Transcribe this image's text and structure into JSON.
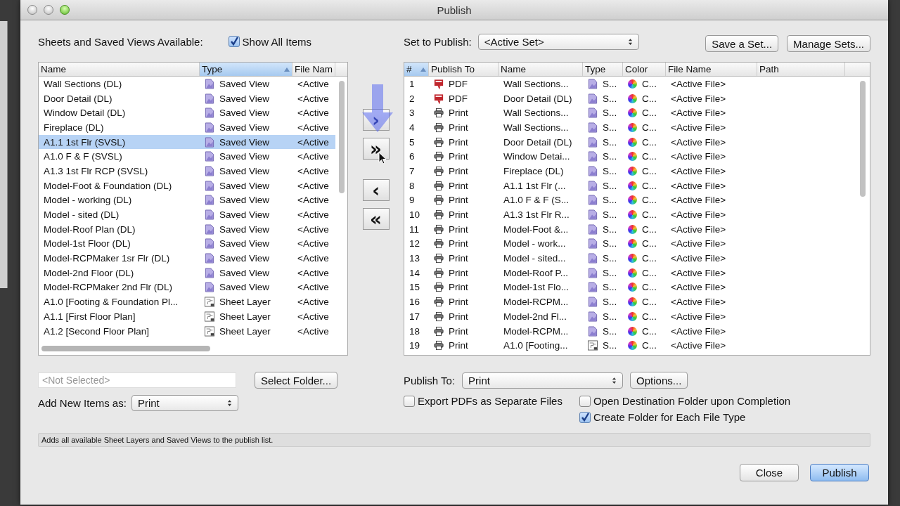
{
  "window": {
    "title": "Publish"
  },
  "available": {
    "label": "Sheets and Saved Views Available:",
    "show_all": {
      "label": "Show All Items",
      "checked": true
    },
    "columns": [
      {
        "label": "Name",
        "sorted": false
      },
      {
        "label": "Type",
        "sorted": true
      },
      {
        "label": "File Nam",
        "sorted": false
      }
    ],
    "rows": [
      {
        "name": "Wall Sections (DL)",
        "kind": "saved_view",
        "type": "Saved View",
        "file": "<Active",
        "selected": false
      },
      {
        "name": "Door Detail (DL)",
        "kind": "saved_view",
        "type": "Saved View",
        "file": "<Active",
        "selected": false
      },
      {
        "name": "Window Detail (DL)",
        "kind": "saved_view",
        "type": "Saved View",
        "file": "<Active",
        "selected": false
      },
      {
        "name": "Fireplace (DL)",
        "kind": "saved_view",
        "type": "Saved View",
        "file": "<Active",
        "selected": false
      },
      {
        "name": "A1.1 1st Flr (SVSL)",
        "kind": "saved_view",
        "type": "Saved View",
        "file": "<Active",
        "selected": true
      },
      {
        "name": "A1.0 F & F (SVSL)",
        "kind": "saved_view",
        "type": "Saved View",
        "file": "<Active",
        "selected": false
      },
      {
        "name": "A1.3 1st Flr RCP (SVSL)",
        "kind": "saved_view",
        "type": "Saved View",
        "file": "<Active",
        "selected": false
      },
      {
        "name": "Model-Foot & Foundation (DL)",
        "kind": "saved_view",
        "type": "Saved View",
        "file": "<Active",
        "selected": false
      },
      {
        "name": "Model - working (DL)",
        "kind": "saved_view",
        "type": "Saved View",
        "file": "<Active",
        "selected": false
      },
      {
        "name": "Model - sited (DL)",
        "kind": "saved_view",
        "type": "Saved View",
        "file": "<Active",
        "selected": false
      },
      {
        "name": "Model-Roof Plan (DL)",
        "kind": "saved_view",
        "type": "Saved View",
        "file": "<Active",
        "selected": false
      },
      {
        "name": "Model-1st Floor (DL)",
        "kind": "saved_view",
        "type": "Saved View",
        "file": "<Active",
        "selected": false
      },
      {
        "name": "Model-RCPMaker 1sr Flr (DL)",
        "kind": "saved_view",
        "type": "Saved View",
        "file": "<Active",
        "selected": false
      },
      {
        "name": "Model-2nd Floor (DL)",
        "kind": "saved_view",
        "type": "Saved View",
        "file": "<Active",
        "selected": false
      },
      {
        "name": "Model-RCPMaker 2nd Flr (DL)",
        "kind": "saved_view",
        "type": "Saved View",
        "file": "<Active",
        "selected": false
      },
      {
        "name": "A1.0 [Footing & Foundation Pl...",
        "kind": "sheet_layer",
        "type": "Sheet Layer",
        "file": "<Active",
        "selected": false
      },
      {
        "name": "A1.1 [First Floor Plan]",
        "kind": "sheet_layer",
        "type": "Sheet Layer",
        "file": "<Active",
        "selected": false
      },
      {
        "name": "A1.2 [Second Floor Plan]",
        "kind": "sheet_layer",
        "type": "Sheet Layer",
        "file": "<Active",
        "selected": false
      }
    ],
    "folder_field": {
      "placeholder": "<Not Selected>"
    },
    "select_folder": "Select Folder...",
    "add_new": {
      "label": "Add New Items as:",
      "value": "Print"
    }
  },
  "transfer_buttons": [
    "›",
    "»",
    "‹",
    "«"
  ],
  "publish_set": {
    "label": "Set to Publish:",
    "value": "<Active Set>",
    "buttons": [
      "Save a Set...",
      "Manage Sets..."
    ],
    "columns": [
      {
        "label": "#",
        "sorted": true
      },
      {
        "label": "Publish To",
        "sorted": false
      },
      {
        "label": "Name",
        "sorted": false
      },
      {
        "label": "Type",
        "sorted": false
      },
      {
        "label": "Color",
        "sorted": false
      },
      {
        "label": "File Name",
        "sorted": false
      },
      {
        "label": "Path",
        "sorted": false
      }
    ],
    "rows": [
      {
        "num": "1",
        "target": {
          "kind": "pdf",
          "text": "PDF"
        },
        "name": "Wall Sections...",
        "type": {
          "kind": "saved_view",
          "text": "S..."
        },
        "color_setting": "C...",
        "file": "<Active File>"
      },
      {
        "num": "2",
        "target": {
          "kind": "pdf",
          "text": "PDF"
        },
        "name": "Door Detail (DL)",
        "type": {
          "kind": "saved_view",
          "text": "S..."
        },
        "color_setting": "C...",
        "file": "<Active File>"
      },
      {
        "num": "3",
        "target": {
          "kind": "print",
          "text": "Print"
        },
        "name": "Wall Sections...",
        "type": {
          "kind": "saved_view",
          "text": "S..."
        },
        "color_setting": "C...",
        "file": "<Active File>"
      },
      {
        "num": "4",
        "target": {
          "kind": "print",
          "text": "Print"
        },
        "name": "Wall Sections...",
        "type": {
          "kind": "saved_view",
          "text": "S..."
        },
        "color_setting": "C...",
        "file": "<Active File>"
      },
      {
        "num": "5",
        "target": {
          "kind": "print",
          "text": "Print"
        },
        "name": "Door Detail (DL)",
        "type": {
          "kind": "saved_view",
          "text": "S..."
        },
        "color_setting": "C...",
        "file": "<Active File>"
      },
      {
        "num": "6",
        "target": {
          "kind": "print",
          "text": "Print"
        },
        "name": "Window Detai...",
        "type": {
          "kind": "saved_view",
          "text": "S..."
        },
        "color_setting": "C...",
        "file": "<Active File>"
      },
      {
        "num": "7",
        "target": {
          "kind": "print",
          "text": "Print"
        },
        "name": "Fireplace (DL)",
        "type": {
          "kind": "saved_view",
          "text": "S..."
        },
        "color_setting": "C...",
        "file": "<Active File>"
      },
      {
        "num": "8",
        "target": {
          "kind": "print",
          "text": "Print"
        },
        "name": "A1.1 1st Flr (...",
        "type": {
          "kind": "saved_view",
          "text": "S..."
        },
        "color_setting": "C...",
        "file": "<Active File>"
      },
      {
        "num": "9",
        "target": {
          "kind": "print",
          "text": "Print"
        },
        "name": "A1.0 F & F (S...",
        "type": {
          "kind": "saved_view",
          "text": "S..."
        },
        "color_setting": "C...",
        "file": "<Active File>"
      },
      {
        "num": "10",
        "target": {
          "kind": "print",
          "text": "Print"
        },
        "name": "A1.3 1st Flr R...",
        "type": {
          "kind": "saved_view",
          "text": "S..."
        },
        "color_setting": "C...",
        "file": "<Active File>"
      },
      {
        "num": "11",
        "target": {
          "kind": "print",
          "text": "Print"
        },
        "name": "Model-Foot &...",
        "type": {
          "kind": "saved_view",
          "text": "S..."
        },
        "color_setting": "C...",
        "file": "<Active File>"
      },
      {
        "num": "12",
        "target": {
          "kind": "print",
          "text": "Print"
        },
        "name": "Model - work...",
        "type": {
          "kind": "saved_view",
          "text": "S..."
        },
        "color_setting": "C...",
        "file": "<Active File>"
      },
      {
        "num": "13",
        "target": {
          "kind": "print",
          "text": "Print"
        },
        "name": "Model - sited...",
        "type": {
          "kind": "saved_view",
          "text": "S..."
        },
        "color_setting": "C...",
        "file": "<Active File>"
      },
      {
        "num": "14",
        "target": {
          "kind": "print",
          "text": "Print"
        },
        "name": "Model-Roof P...",
        "type": {
          "kind": "saved_view",
          "text": "S..."
        },
        "color_setting": "C...",
        "file": "<Active File>"
      },
      {
        "num": "15",
        "target": {
          "kind": "print",
          "text": "Print"
        },
        "name": "Model-1st Flo...",
        "type": {
          "kind": "saved_view",
          "text": "S..."
        },
        "color_setting": "C...",
        "file": "<Active File>"
      },
      {
        "num": "16",
        "target": {
          "kind": "print",
          "text": "Print"
        },
        "name": "Model-RCPM...",
        "type": {
          "kind": "saved_view",
          "text": "S..."
        },
        "color_setting": "C...",
        "file": "<Active File>"
      },
      {
        "num": "17",
        "target": {
          "kind": "print",
          "text": "Print"
        },
        "name": "Model-2nd Fl...",
        "type": {
          "kind": "saved_view",
          "text": "S..."
        },
        "color_setting": "C...",
        "file": "<Active File>"
      },
      {
        "num": "18",
        "target": {
          "kind": "print",
          "text": "Print"
        },
        "name": "Model-RCPM...",
        "type": {
          "kind": "saved_view",
          "text": "S..."
        },
        "color_setting": "C...",
        "file": "<Active File>"
      },
      {
        "num": "19",
        "target": {
          "kind": "print",
          "text": "Print"
        },
        "name": "A1.0 [Footing...",
        "type": {
          "kind": "sheet_layer",
          "text": "S..."
        },
        "color_setting": "C...",
        "file": "<Active File>"
      }
    ],
    "publish_to": {
      "label": "Publish To:",
      "value": "Print"
    },
    "options": "Options...",
    "checkboxes": [
      {
        "label": "Export PDFs as Separate Files",
        "checked": false
      },
      {
        "label": "Open Destination Folder upon Completion",
        "checked": false
      },
      {
        "label": "Create Folder for Each File Type",
        "checked": true
      }
    ]
  },
  "status_bar": "Adds all available Sheet Layers and Saved Views to the publish list.",
  "buttons": [
    {
      "label": "Close",
      "default": false
    },
    {
      "label": "Publish",
      "default": true
    }
  ]
}
